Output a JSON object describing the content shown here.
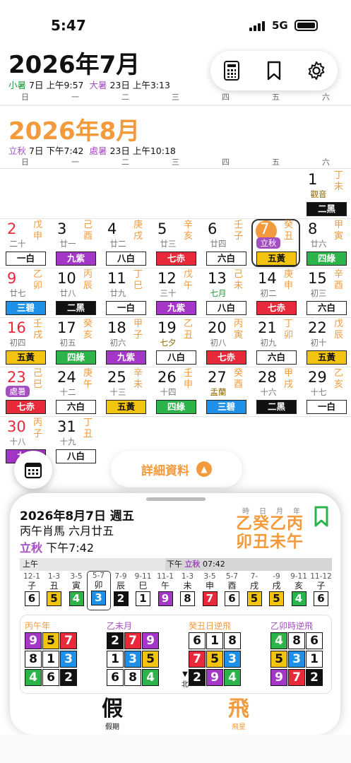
{
  "status": {
    "time": "5:47",
    "network": "5G"
  },
  "month1": {
    "title": "2026年7月",
    "t1_name": "小暑",
    "t1_day": "7日",
    "t1_time": "上午9:57",
    "t2_name": "大暑",
    "t2_day": "23日",
    "t2_time": "上午3:13"
  },
  "weekdays": [
    "日",
    "一",
    "二",
    "三",
    "四",
    "五",
    "六"
  ],
  "month2": {
    "title": "2026年8月",
    "t1_name": "立秋",
    "t1_day": "7日",
    "t1_time": "下午7:42",
    "t2_name": "處暑",
    "t2_day": "23日",
    "t2_time": "上午10:18"
  },
  "days": [
    {
      "d": "1",
      "lu": "觀音",
      "gz": "丁未",
      "s": "二黑",
      "c": 2,
      "col": 6,
      "row": 0,
      "lc": "gold"
    },
    {
      "d": "2",
      "lu": "二十",
      "gz": "戊申",
      "s": "一白",
      "c": 1,
      "col": 0,
      "row": 1,
      "red": true
    },
    {
      "d": "3",
      "lu": "廿一",
      "gz": "己酉",
      "s": "九紫",
      "c": 9,
      "col": 1,
      "row": 1
    },
    {
      "d": "4",
      "lu": "廿二",
      "gz": "庚戌",
      "s": "八白",
      "c": 8,
      "col": 2,
      "row": 1
    },
    {
      "d": "5",
      "lu": "廿三",
      "gz": "辛亥",
      "s": "七赤",
      "c": 7,
      "col": 3,
      "row": 1
    },
    {
      "d": "6",
      "lu": "廿四",
      "gz": "壬子",
      "s": "六白",
      "c": 6,
      "col": 4,
      "row": 1
    },
    {
      "d": "7",
      "lu": "立秋",
      "gz": "癸丑",
      "s": "五黃",
      "c": 5,
      "col": 5,
      "row": 1,
      "term": true,
      "sel": true
    },
    {
      "d": "8",
      "lu": "廿六",
      "gz": "甲寅",
      "s": "四綠",
      "c": 4,
      "col": 6,
      "row": 1
    },
    {
      "d": "9",
      "lu": "廿七",
      "gz": "乙卯",
      "s": "三碧",
      "c": 3,
      "col": 0,
      "row": 2,
      "red": true
    },
    {
      "d": "10",
      "lu": "廿八",
      "gz": "丙辰",
      "s": "二黑",
      "c": 2,
      "col": 1,
      "row": 2
    },
    {
      "d": "11",
      "lu": "廿九",
      "gz": "丁巳",
      "s": "一白",
      "c": 1,
      "col": 2,
      "row": 2
    },
    {
      "d": "12",
      "lu": "三十",
      "gz": "戊午",
      "s": "九紫",
      "c": 9,
      "col": 3,
      "row": 2
    },
    {
      "d": "13",
      "lu": "七月",
      "gz": "己未",
      "s": "八白",
      "c": 8,
      "col": 4,
      "row": 2,
      "lc": "green"
    },
    {
      "d": "14",
      "lu": "初二",
      "gz": "庚申",
      "s": "七赤",
      "c": 7,
      "col": 5,
      "row": 2
    },
    {
      "d": "15",
      "lu": "初三",
      "gz": "辛酉",
      "s": "六白",
      "c": 6,
      "col": 6,
      "row": 2
    },
    {
      "d": "16",
      "lu": "初四",
      "gz": "壬戌",
      "s": "五黃",
      "c": 5,
      "col": 0,
      "row": 3,
      "red": true
    },
    {
      "d": "17",
      "lu": "初五",
      "gz": "癸亥",
      "s": "四綠",
      "c": 4,
      "col": 1,
      "row": 3
    },
    {
      "d": "18",
      "lu": "初六",
      "gz": "甲子",
      "s": "九紫",
      "c": 9,
      "col": 2,
      "row": 3
    },
    {
      "d": "19",
      "lu": "七夕",
      "gz": "乙丑",
      "s": "八白",
      "c": 8,
      "col": 3,
      "row": 3,
      "lc": "gold"
    },
    {
      "d": "20",
      "lu": "初八",
      "gz": "丙寅",
      "s": "七赤",
      "c": 7,
      "col": 4,
      "row": 3
    },
    {
      "d": "21",
      "lu": "初九",
      "gz": "丁卯",
      "s": "六白",
      "c": 6,
      "col": 5,
      "row": 3
    },
    {
      "d": "22",
      "lu": "初十",
      "gz": "戊辰",
      "s": "五黃",
      "c": 5,
      "col": 6,
      "row": 3
    },
    {
      "d": "23",
      "lu": "處暑",
      "gz": "己巳",
      "s": "七赤",
      "c": 7,
      "col": 0,
      "row": 4,
      "red": true,
      "term": true
    },
    {
      "d": "24",
      "lu": "十二",
      "gz": "庚午",
      "s": "六白",
      "c": 6,
      "col": 1,
      "row": 4
    },
    {
      "d": "25",
      "lu": "十三",
      "gz": "辛未",
      "s": "五黃",
      "c": 5,
      "col": 2,
      "row": 4
    },
    {
      "d": "26",
      "lu": "十四",
      "gz": "壬申",
      "s": "四綠",
      "c": 4,
      "col": 3,
      "row": 4
    },
    {
      "d": "27",
      "lu": "盂蘭",
      "gz": "癸酉",
      "s": "三碧",
      "c": 3,
      "col": 4,
      "row": 4,
      "lc": "gold"
    },
    {
      "d": "28",
      "lu": "十六",
      "gz": "甲戌",
      "s": "二黑",
      "c": 2,
      "col": 5,
      "row": 4
    },
    {
      "d": "29",
      "lu": "十七",
      "gz": "乙亥",
      "s": "一白",
      "c": 1,
      "col": 6,
      "row": 4
    },
    {
      "d": "30",
      "lu": "十八",
      "gz": "丙子",
      "s": "九紫",
      "c": 9,
      "col": 0,
      "row": 5,
      "red": true
    },
    {
      "d": "31",
      "lu": "十九",
      "gz": "丁丑",
      "s": "八白",
      "c": 8,
      "col": 1,
      "row": 5
    }
  ],
  "details_label": "詳細資料",
  "panel": {
    "date": "2026年8月7日 週五",
    "lunar": "丙午肖馬 六月廿五",
    "term": "立秋",
    "term_time": "下午7:42",
    "gz_labels": [
      "時",
      "日",
      "月",
      "年"
    ],
    "gz_row1": "乙癸乙丙",
    "gz_row2": "卯丑未午",
    "am": "上午",
    "pm": "下午",
    "pm_term": "立秋",
    "pm_time": "07:42",
    "hours": [
      {
        "r": "12-1",
        "b": "子",
        "n": 6
      },
      {
        "r": "1-3",
        "b": "丑",
        "n": 5
      },
      {
        "r": "3-5",
        "b": "寅",
        "n": 4
      },
      {
        "r": "5-7",
        "b": "卯",
        "n": 3
      },
      {
        "r": "7-9",
        "b": "辰",
        "n": 2
      },
      {
        "r": "9-11",
        "b": "巳",
        "n": 1
      },
      {
        "r": "11-1",
        "b": "午",
        "n": 9
      },
      {
        "r": "1-3",
        "b": "未",
        "n": 8
      },
      {
        "r": "3-5",
        "b": "申",
        "n": 7
      },
      {
        "r": "5-7",
        "b": "酉",
        "n": 6
      },
      {
        "r": "7-",
        "b": "戌",
        "n": 5
      },
      {
        "r": "-9",
        "b": "戌",
        "n": 5
      },
      {
        "r": "9-11",
        "b": "亥",
        "n": 4
      },
      {
        "r": "11-12",
        "b": "子",
        "n": 6
      }
    ],
    "grids": [
      {
        "title": "丙午年",
        "cells": [
          9,
          5,
          7,
          8,
          1,
          3,
          4,
          6,
          2
        ]
      },
      {
        "title": "乙未月",
        "cells": [
          2,
          7,
          9,
          1,
          3,
          5,
          6,
          8,
          4
        ]
      },
      {
        "title": "癸丑日逆飛",
        "cells": [
          6,
          1,
          8,
          7,
          5,
          3,
          2,
          9,
          4
        ]
      },
      {
        "title": "乙卯時逆飛",
        "cells": [
          4,
          8,
          6,
          5,
          3,
          1,
          9,
          7,
          2
        ]
      }
    ],
    "north": "北",
    "tabs": [
      {
        "g": "假",
        "l": "假期"
      },
      {
        "g": "飛",
        "l": "飛星"
      }
    ]
  },
  "colors": {
    "accent": "#f39a3d",
    "purple": "#a44fc0",
    "red": "#e8293a"
  }
}
